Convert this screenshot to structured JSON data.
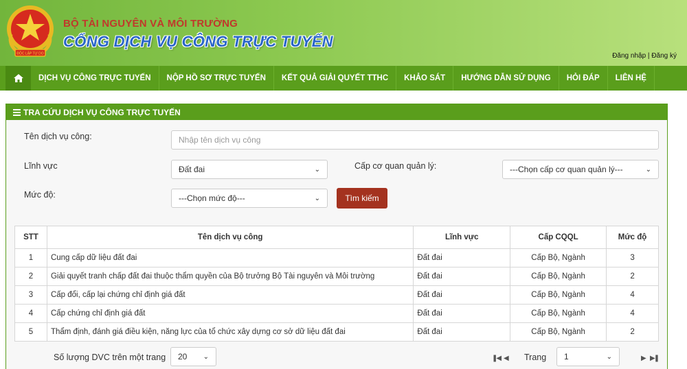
{
  "header": {
    "ministry": "BỘ TÀI NGUYÊN VÀ MÔI TRƯỜNG",
    "portal": "CỔNG DỊCH VỤ CÔNG TRỰC TUYẾN",
    "emblem_text": "ĐỘC LẬP TỰ DO",
    "login": "Đăng nhập",
    "sep": "|",
    "register": "Đăng ký"
  },
  "nav": {
    "home_icon": "home-icon",
    "items": [
      "DỊCH VỤ CÔNG TRỰC TUYẾN",
      "NỘP HỒ SƠ TRỰC TUYẾN",
      "KẾT QUẢ GIẢI QUYẾT TTHC",
      "KHẢO SÁT",
      "HƯỚNG DẪN SỬ DỤNG",
      "HỎI ĐÁP",
      "LIÊN HỆ"
    ]
  },
  "panel": {
    "title": "TRA CỨU DỊCH VỤ CÔNG TRỰC TUYẾN",
    "service_label": "Tên dịch vụ công:",
    "service_placeholder": "Nhập tên dịch vụ công",
    "field_label": "Lĩnh vực",
    "field_value": "Đất đai",
    "agency_label": "Cấp cơ quan quản lý:",
    "agency_value": "---Chọn cấp cơ quan quản lý---",
    "level_label": "Mức độ:",
    "level_value": "---Chọn mức độ---",
    "search_button": "Tìm kiếm"
  },
  "table": {
    "headers": [
      "STT",
      "Tên dịch vụ công",
      "Lĩnh vực",
      "Cấp CQQL",
      "Mức độ"
    ],
    "rows": [
      [
        "1",
        "Cung cấp dữ liệu đất đai",
        "Đất đai",
        "Cấp Bộ, Ngành",
        "3"
      ],
      [
        "2",
        "Giải quyết tranh chấp đất đai thuộc thẩm quyền của Bộ trưởng Bộ Tài nguyên và Môi trường",
        "Đất đai",
        "Cấp Bộ, Ngành",
        "2"
      ],
      [
        "3",
        "Cấp đổi, cấp lại chứng chỉ định giá đất",
        "Đất đai",
        "Cấp Bộ, Ngành",
        "4"
      ],
      [
        "4",
        "Cấp chứng chỉ định giá đất",
        "Đất đai",
        "Cấp Bộ, Ngành",
        "4"
      ],
      [
        "5",
        "Thẩm định, đánh giá điều kiện, năng lực của tổ chức xây dựng cơ sở dữ liệu đất đai",
        "Đất đai",
        "Cấp Bộ, Ngành",
        "2"
      ]
    ]
  },
  "pager": {
    "per_page_label": "Số lượng DVC trên một trang",
    "per_page_value": "20",
    "page_label": "Trang",
    "page_value": "1"
  },
  "colors": {
    "nav_green": "#5a9e1c",
    "button_red": "#a4321f",
    "title_blue": "#2a66c9",
    "ministry_red": "#c0392b"
  }
}
